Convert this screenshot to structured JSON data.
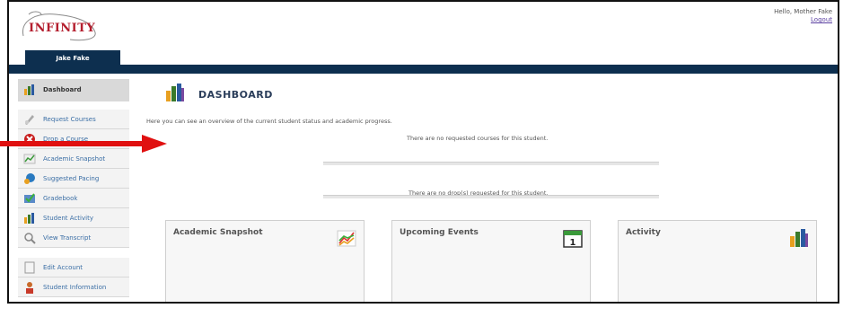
{
  "header": {
    "logo_text": "INFINITY",
    "greeting": "Hello, Mother Fake",
    "logout_label": "Logout",
    "user_tab": "Jake Fake"
  },
  "sidebar": {
    "items": [
      {
        "label": "Dashboard",
        "icon": "dashboard-icon",
        "active": true
      },
      {
        "label": "Request Courses",
        "icon": "request-icon"
      },
      {
        "label": "Drop a Course",
        "icon": "drop-icon"
      },
      {
        "label": "Academic Snapshot",
        "icon": "snapshot-icon"
      },
      {
        "label": "Suggested Pacing",
        "icon": "pacing-icon"
      },
      {
        "label": "Gradebook",
        "icon": "gradebook-icon"
      },
      {
        "label": "Student Activity",
        "icon": "activity-icon"
      },
      {
        "label": "View Transcript",
        "icon": "transcript-icon"
      },
      {
        "label": "Edit Account",
        "icon": "account-icon"
      },
      {
        "label": "Student Information",
        "icon": "student-info-icon"
      }
    ]
  },
  "main": {
    "title": "DASHBOARD",
    "intro": "Here you can see an overview of the current student status and academic progress.",
    "no_requested": "There are no requested courses for this student.",
    "no_drops": "There are no drop(s) requested for this student."
  },
  "panels": [
    {
      "title": "Academic Snapshot",
      "icon": "chart-line-icon"
    },
    {
      "title": "Upcoming Events",
      "icon": "calendar-icon"
    },
    {
      "title": "Activity",
      "icon": "bar-chart-icon"
    }
  ],
  "colors": {
    "navbar": "#0d2f4f",
    "link": "#3a6ea5",
    "arrow": "#e01010",
    "logo": "#b41e2e"
  }
}
